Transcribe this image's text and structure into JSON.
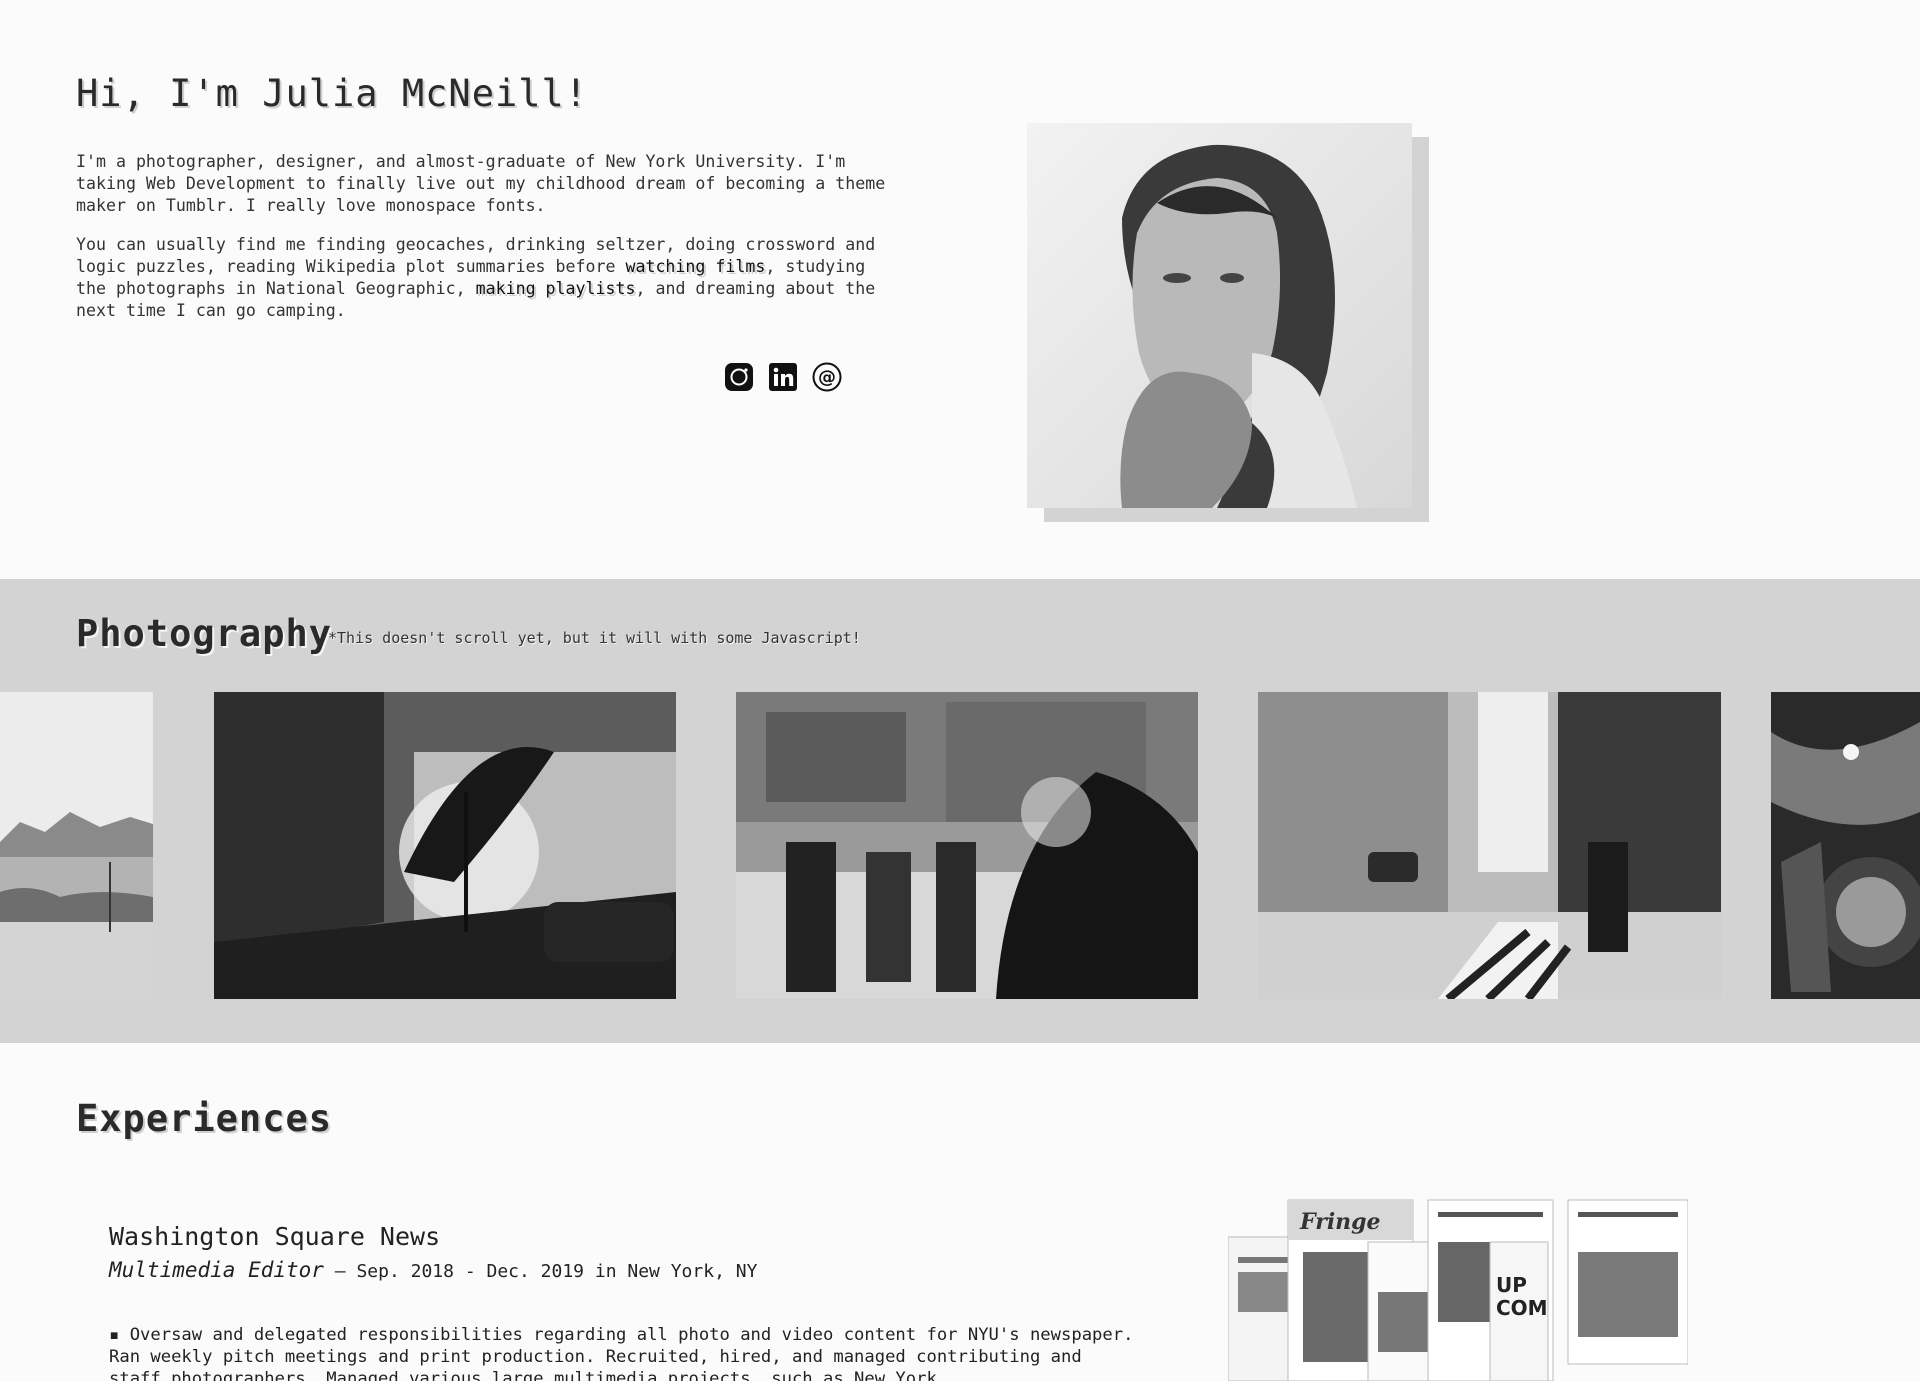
{
  "intro": {
    "greeting": "Hi, I'm Julia McNeill!",
    "bio1": "I'm a photographer, designer, and almost-graduate of New York University. I'm taking Web Development to finally live out my childhood dream of becoming a theme maker on Tumblr. I really love monospace fonts.",
    "bio2_a": "You can usually find me finding geocaches, drinking seltzer, doing crossword and logic puzzles, reading Wikipedia plot summaries before ",
    "bio2_link1": "watching films",
    "bio2_b": ", studying the photographs in National Geographic, ",
    "bio2_link2": "making playlists",
    "bio2_c": ", and dreaming about the next time I can go camping.",
    "socials": [
      "instagram-icon",
      "linkedin-icon",
      "email-icon"
    ]
  },
  "photography": {
    "title": "Photography",
    "note": "*This doesn't scroll yet, but it will with some Javascript!"
  },
  "experiences": {
    "title": "Experiences",
    "jobs": [
      {
        "org": "Washington Square News",
        "role": "Multimedia Editor",
        "dates": " — Sep. 2018 - Dec. 2019 in New York, NY",
        "description": "▪ Oversaw and delegated responsibilities regarding all photo and video content for NYU's newspaper. Ran weekly pitch meetings and print production. Recruited, hired, and managed contributing and staff photographers. Managed various large multimedia projects, such as New York"
      }
    ]
  },
  "colors": {
    "band": "#d3d3d3",
    "page": "#fbfbfb",
    "text": "#222222"
  }
}
